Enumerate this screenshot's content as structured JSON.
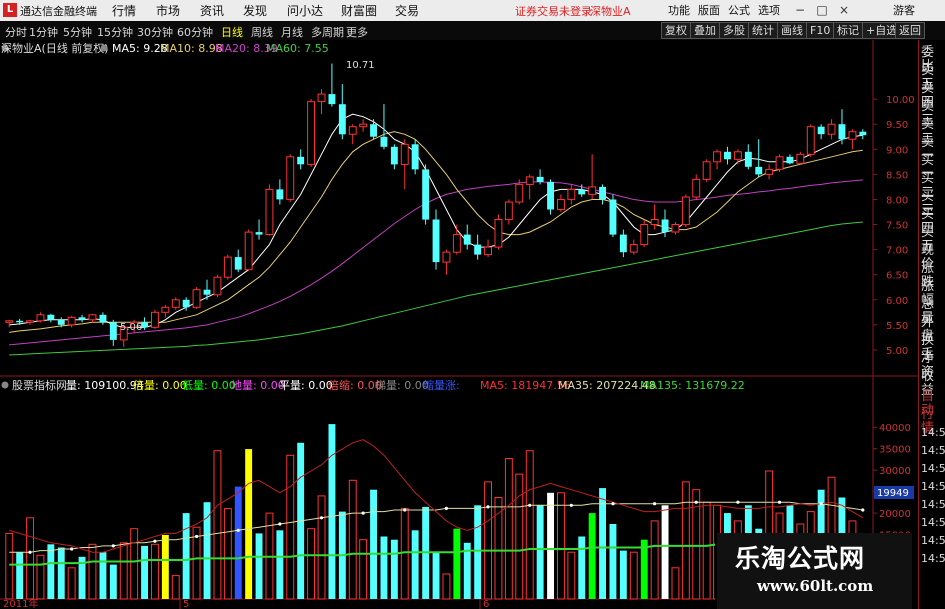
{
  "titlebar": {
    "app_name": "通达信金融终端",
    "menus": [
      "行情",
      "市场",
      "资讯",
      "发现",
      "问小达",
      "财富圈",
      "交易"
    ],
    "login_text": "证券交易未登录",
    "stock_text": "深物业A",
    "right_menus": [
      "功能",
      "版面",
      "公式",
      "选项"
    ],
    "guest": "游客"
  },
  "toolbar": {
    "periods": [
      "分时",
      "1分钟",
      "5分钟",
      "15分钟",
      "30分钟",
      "60分钟",
      "日线",
      "周线",
      "月线",
      "多周期",
      "更多"
    ],
    "active_period": "日线",
    "right_buttons": [
      "复权",
      "叠加",
      "多股",
      "统计",
      "画线",
      "F10",
      "标记",
      "+自选",
      "返回"
    ]
  },
  "main_chart": {
    "title": "深物业A(日线 前复权)",
    "ma5": "MA5: 9.28",
    "ma10": "MA10: 8.98",
    "ma20": "MA20: 8.39",
    "ma60": "MA60: 7.55",
    "max_label": "10.71",
    "min_label": "5.06",
    "price_axis": [
      "10.00",
      "9.50",
      "9.00",
      "8.50",
      "8.00",
      "7.50",
      "7.00",
      "6.50",
      "6.00",
      "5.50",
      "5.00"
    ]
  },
  "volume_chart": {
    "title": "股票指标网",
    "items": [
      {
        "label": "量: 109100.94",
        "color": "#ffffff"
      },
      {
        "label": "倍量: 0.00",
        "color": "#ffff00"
      },
      {
        "label": "低量: 0.00",
        "color": "#00ff00"
      },
      {
        "label": "地量: 0.00",
        "color": "#ff44ff"
      },
      {
        "label": "平量: 0.00",
        "color": "#ffffff"
      },
      {
        "label": "倍缩: 0.00",
        "color": "#ff5555"
      },
      {
        "label": "梯量: 0.00",
        "color": "#888888"
      },
      {
        "label": "缩量涨: ",
        "color": "#3355ff"
      },
      {
        "label": "MA5: 181947.56",
        "color": "#ff3030"
      },
      {
        "label": "MA35: 207224.48",
        "color": "#e0e0a0"
      },
      {
        "label": "MA135: 131679.22",
        "color": "#33dd33"
      }
    ],
    "volume_axis": [
      "40000",
      "35000",
      "30000",
      "25000",
      "20000",
      "15000"
    ],
    "current_value": "19949"
  },
  "date_axis": [
    "2011年",
    "5",
    "6"
  ],
  "right_panel": [
    "委比",
    "卖五",
    "卖四",
    "卖三",
    "卖二",
    "卖一",
    "买一",
    "买二",
    "买三",
    "买四",
    "买五",
    "现价",
    "涨跌",
    "涨幅",
    "总量",
    "外盘",
    "换手",
    "净资",
    "收益",
    "自动",
    "行情",
    "14:50",
    "14:50",
    "14:50",
    "14:50",
    "14:50",
    "14:50",
    "14:50",
    "14:50"
  ],
  "watermark": {
    "title": "乐淘公式网",
    "url": "www.60lt.com"
  },
  "chart_data": {
    "type": "candlestick",
    "title": "深物业A(日线 前复权)",
    "ylim": [
      4.6,
      10.9
    ],
    "ohlc": [
      [
        5.55,
        5.6,
        5.45,
        5.58
      ],
      [
        5.58,
        5.62,
        5.5,
        5.55
      ],
      [
        5.55,
        5.6,
        5.5,
        5.58
      ],
      [
        5.58,
        5.75,
        5.55,
        5.7
      ],
      [
        5.7,
        5.72,
        5.55,
        5.6
      ],
      [
        5.6,
        5.65,
        5.45,
        5.5
      ],
      [
        5.5,
        5.68,
        5.45,
        5.65
      ],
      [
        5.65,
        5.7,
        5.55,
        5.6
      ],
      [
        5.6,
        5.72,
        5.55,
        5.7
      ],
      [
        5.7,
        5.75,
        5.5,
        5.55
      ],
      [
        5.55,
        5.6,
        5.08,
        5.2
      ],
      [
        5.2,
        5.5,
        5.06,
        5.45
      ],
      [
        5.45,
        5.6,
        5.35,
        5.55
      ],
      [
        5.55,
        5.65,
        5.4,
        5.45
      ],
      [
        5.45,
        5.8,
        5.42,
        5.75
      ],
      [
        5.75,
        5.9,
        5.65,
        5.85
      ],
      [
        5.85,
        6.05,
        5.8,
        6.0
      ],
      [
        6.0,
        6.05,
        5.78,
        5.85
      ],
      [
        5.85,
        6.25,
        5.82,
        6.2
      ],
      [
        6.2,
        6.4,
        6.0,
        6.1
      ],
      [
        6.1,
        6.5,
        6.05,
        6.45
      ],
      [
        6.45,
        6.9,
        6.4,
        6.85
      ],
      [
        6.85,
        7.0,
        6.55,
        6.6
      ],
      [
        6.6,
        7.4,
        6.58,
        7.35
      ],
      [
        7.35,
        7.6,
        7.2,
        7.3
      ],
      [
        7.3,
        8.3,
        7.28,
        8.2
      ],
      [
        8.2,
        8.4,
        7.9,
        8.0
      ],
      [
        8.0,
        8.9,
        7.95,
        8.85
      ],
      [
        8.85,
        9.0,
        8.6,
        8.7
      ],
      [
        8.7,
        10.0,
        8.65,
        9.95
      ],
      [
        9.95,
        10.2,
        9.7,
        10.1
      ],
      [
        10.1,
        10.71,
        9.85,
        9.9
      ],
      [
        9.9,
        10.3,
        9.2,
        9.3
      ],
      [
        9.3,
        9.5,
        9.1,
        9.45
      ],
      [
        9.45,
        9.6,
        9.35,
        9.5
      ],
      [
        9.5,
        9.6,
        9.2,
        9.25
      ],
      [
        9.25,
        9.9,
        9.0,
        9.05
      ],
      [
        9.05,
        9.1,
        8.6,
        8.7
      ],
      [
        8.7,
        9.2,
        8.2,
        9.1
      ],
      [
        9.1,
        9.2,
        8.5,
        8.6
      ],
      [
        8.6,
        8.7,
        7.5,
        7.6
      ],
      [
        7.6,
        7.8,
        6.6,
        6.75
      ],
      [
        6.75,
        7.0,
        6.5,
        6.95
      ],
      [
        6.95,
        7.5,
        6.9,
        7.3
      ],
      [
        7.3,
        7.5,
        7.0,
        7.1
      ],
      [
        7.1,
        7.3,
        6.8,
        6.9
      ],
      [
        6.9,
        7.2,
        6.85,
        7.05
      ],
      [
        7.05,
        7.7,
        7.0,
        7.6
      ],
      [
        7.6,
        8.0,
        7.5,
        7.95
      ],
      [
        7.95,
        8.4,
        7.9,
        8.3
      ],
      [
        8.3,
        8.5,
        8.0,
        8.45
      ],
      [
        8.45,
        8.6,
        8.3,
        8.35
      ],
      [
        8.35,
        8.4,
        7.7,
        7.8
      ],
      [
        7.8,
        8.1,
        7.75,
        8.0
      ],
      [
        8.0,
        8.3,
        7.9,
        8.2
      ],
      [
        8.2,
        8.3,
        8.05,
        8.1
      ],
      [
        8.1,
        8.9,
        8.0,
        8.25
      ],
      [
        8.25,
        8.3,
        7.9,
        8.0
      ],
      [
        8.0,
        8.1,
        7.25,
        7.3
      ],
      [
        7.3,
        7.4,
        6.85,
        6.95
      ],
      [
        6.95,
        7.2,
        6.9,
        7.1
      ],
      [
        7.1,
        7.6,
        7.05,
        7.5
      ],
      [
        7.5,
        7.9,
        7.4,
        7.6
      ],
      [
        7.6,
        7.8,
        7.25,
        7.35
      ],
      [
        7.35,
        7.55,
        7.3,
        7.5
      ],
      [
        7.5,
        8.1,
        7.45,
        8.05
      ],
      [
        8.05,
        8.5,
        8.0,
        8.4
      ],
      [
        8.4,
        8.8,
        8.35,
        8.75
      ],
      [
        8.75,
        9.0,
        8.6,
        8.95
      ],
      [
        8.95,
        9.05,
        8.7,
        8.8
      ],
      [
        8.8,
        9.0,
        8.7,
        8.95
      ],
      [
        8.95,
        9.1,
        8.6,
        8.65
      ],
      [
        8.65,
        9.2,
        8.45,
        8.5
      ],
      [
        8.5,
        8.7,
        8.4,
        8.6
      ],
      [
        8.6,
        8.9,
        8.55,
        8.85
      ],
      [
        8.85,
        8.9,
        8.7,
        8.72
      ],
      [
        8.72,
        8.95,
        8.7,
        8.9
      ],
      [
        8.9,
        9.5,
        8.85,
        9.45
      ],
      [
        9.45,
        9.5,
        9.2,
        9.3
      ],
      [
        9.3,
        9.6,
        9.2,
        9.5
      ],
      [
        9.5,
        9.8,
        9.1,
        9.2
      ],
      [
        9.2,
        9.4,
        9.0,
        9.35
      ],
      [
        9.35,
        9.4,
        9.2,
        9.28
      ]
    ],
    "ma5": [
      5.5,
      5.52,
      5.55,
      5.58,
      5.6,
      5.6,
      5.6,
      5.6,
      5.62,
      5.6,
      5.5,
      5.45,
      5.45,
      5.45,
      5.5,
      5.6,
      5.75,
      5.85,
      5.95,
      6.05,
      6.15,
      6.3,
      6.45,
      6.6,
      6.85,
      7.1,
      7.5,
      7.8,
      8.1,
      8.5,
      8.9,
      9.3,
      9.6,
      9.7,
      9.65,
      9.55,
      9.4,
      9.2,
      9.1,
      8.95,
      8.6,
      8.2,
      7.8,
      7.4,
      7.15,
      7.05,
      7.05,
      7.1,
      7.25,
      7.5,
      7.75,
      8.0,
      8.15,
      8.2,
      8.2,
      8.2,
      8.15,
      8.1,
      7.95,
      7.7,
      7.45,
      7.3,
      7.3,
      7.35,
      7.4,
      7.55,
      7.8,
      8.05,
      8.3,
      8.55,
      8.75,
      8.82,
      8.8,
      8.75,
      8.75,
      8.75,
      8.8,
      8.9,
      9.0,
      9.1,
      9.2,
      9.25,
      9.28
    ],
    "ma10": [
      5.35,
      5.38,
      5.4,
      5.42,
      5.45,
      5.48,
      5.5,
      5.52,
      5.55,
      5.55,
      5.55,
      5.55,
      5.55,
      5.55,
      5.55,
      5.55,
      5.6,
      5.65,
      5.7,
      5.8,
      5.9,
      6.0,
      6.15,
      6.3,
      6.45,
      6.65,
      6.9,
      7.15,
      7.45,
      7.75,
      8.05,
      8.4,
      8.7,
      8.95,
      9.1,
      9.2,
      9.3,
      9.35,
      9.3,
      9.2,
      9.0,
      8.75,
      8.5,
      8.2,
      7.95,
      7.7,
      7.5,
      7.35,
      7.3,
      7.3,
      7.35,
      7.45,
      7.55,
      7.7,
      7.85,
      7.95,
      8.0,
      8.0,
      7.95,
      7.85,
      7.7,
      7.6,
      7.5,
      7.45,
      7.4,
      7.4,
      7.45,
      7.6,
      7.75,
      7.95,
      8.15,
      8.3,
      8.45,
      8.55,
      8.6,
      8.65,
      8.7,
      8.75,
      8.8,
      8.85,
      8.9,
      8.95,
      8.98
    ],
    "ma20": [
      5.1,
      5.12,
      5.14,
      5.16,
      5.18,
      5.2,
      5.22,
      5.24,
      5.26,
      5.28,
      5.3,
      5.32,
      5.34,
      5.36,
      5.38,
      5.4,
      5.42,
      5.44,
      5.47,
      5.5,
      5.55,
      5.6,
      5.65,
      5.72,
      5.8,
      5.88,
      5.97,
      6.07,
      6.18,
      6.3,
      6.43,
      6.57,
      6.72,
      6.88,
      7.04,
      7.2,
      7.36,
      7.52,
      7.66,
      7.8,
      7.92,
      8.02,
      8.1,
      8.15,
      8.2,
      8.23,
      8.26,
      8.28,
      8.3,
      8.33,
      8.35,
      8.35,
      8.34,
      8.33,
      8.3,
      8.25,
      8.2,
      8.15,
      8.1,
      8.05,
      8.0,
      7.97,
      7.95,
      7.95,
      7.95,
      7.97,
      8.0,
      8.02,
      8.05,
      8.08,
      8.1,
      8.12,
      8.15,
      8.17,
      8.2,
      8.22,
      8.25,
      8.28,
      8.3,
      8.33,
      8.35,
      8.37,
      8.39
    ],
    "ma60": [
      4.9,
      4.91,
      4.92,
      4.93,
      4.94,
      4.95,
      4.96,
      4.97,
      4.98,
      4.99,
      5.0,
      5.01,
      5.02,
      5.03,
      5.04,
      5.05,
      5.06,
      5.07,
      5.09,
      5.1,
      5.12,
      5.14,
      5.16,
      5.18,
      5.2,
      5.23,
      5.26,
      5.29,
      5.32,
      5.36,
      5.4,
      5.44,
      5.48,
      5.53,
      5.58,
      5.63,
      5.68,
      5.73,
      5.78,
      5.83,
      5.88,
      5.93,
      5.98,
      6.03,
      6.08,
      6.12,
      6.16,
      6.2,
      6.24,
      6.28,
      6.32,
      6.36,
      6.4,
      6.44,
      6.48,
      6.52,
      6.56,
      6.6,
      6.64,
      6.68,
      6.72,
      6.76,
      6.8,
      6.84,
      6.88,
      6.92,
      6.96,
      7.0,
      7.04,
      7.08,
      7.12,
      7.16,
      7.2,
      7.24,
      7.28,
      7.32,
      7.36,
      7.4,
      7.44,
      7.48,
      7.51,
      7.53,
      7.55
    ],
    "volumes": [
      42,
      30,
      52,
      28,
      35,
      33,
      20,
      27,
      35,
      30,
      22,
      36,
      45,
      34,
      35,
      41,
      15,
      55,
      46,
      62,
      95,
      58,
      72,
      96,
      42,
      55,
      44,
      92,
      100,
      45,
      66,
      112,
      56,
      76,
      38,
      70,
      40,
      38,
      58,
      44,
      59,
      30,
      16,
      45,
      36,
      60,
      75,
      65,
      90,
      80,
      95,
      60,
      68,
      68,
      30,
      40,
      55,
      71,
      48,
      31,
      30,
      38,
      50,
      60,
      20,
      75,
      70,
      62,
      60,
      55,
      50,
      60,
      45,
      82,
      55,
      60,
      48,
      56,
      70,
      78,
      65,
      50,
      28
    ],
    "vol_ma5": [
      44,
      42,
      40,
      38,
      36,
      35,
      34,
      32,
      30,
      30,
      32,
      34,
      36,
      38,
      40,
      42,
      42,
      45,
      48,
      52,
      60,
      64,
      68,
      74,
      76,
      72,
      68,
      72,
      78,
      82,
      86,
      92,
      96,
      100,
      102,
      98,
      92,
      84,
      76,
      68,
      62,
      56,
      50,
      46,
      44,
      46,
      50,
      55,
      60,
      66,
      70,
      72,
      74,
      72,
      70,
      68,
      66,
      64,
      62,
      60,
      58,
      56,
      56,
      57,
      58,
      58,
      59,
      60,
      60,
      59,
      58,
      58,
      58,
      59,
      59,
      60,
      61,
      60,
      61,
      62,
      60,
      56,
      52
    ],
    "vol_ma35": [
      30,
      30,
      30,
      31,
      31,
      32,
      32,
      33,
      33,
      34,
      34,
      35,
      36,
      36,
      37,
      38,
      38,
      39,
      40,
      41,
      42,
      43,
      44,
      45,
      46,
      47,
      48,
      49,
      50,
      51,
      52,
      53,
      54,
      55,
      55,
      56,
      56,
      57,
      57,
      57,
      57,
      57,
      58,
      58,
      58,
      58,
      59,
      59,
      59,
      59,
      60,
      60,
      60,
      60,
      60,
      60,
      61,
      61,
      61,
      61,
      61,
      61,
      61,
      61,
      61,
      62,
      62,
      62,
      62,
      62,
      62,
      62,
      62,
      62,
      62,
      62,
      61,
      61,
      61,
      60,
      59,
      58,
      57
    ],
    "vol_ma135": [
      22,
      22,
      22,
      22,
      23,
      23,
      23,
      23,
      24,
      24,
      24,
      24,
      24,
      25,
      25,
      25,
      25,
      25,
      26,
      26,
      26,
      26,
      26,
      27,
      27,
      27,
      27,
      27,
      28,
      28,
      28,
      28,
      28,
      29,
      29,
      29,
      29,
      29,
      30,
      30,
      30,
      30,
      30,
      30,
      31,
      31,
      31,
      31,
      31,
      31,
      32,
      32,
      32,
      32,
      32,
      32,
      33,
      33,
      33,
      33,
      33,
      33,
      34,
      34,
      34,
      34,
      34,
      34,
      35,
      35,
      35,
      35,
      35,
      35,
      35,
      36,
      36,
      36,
      36,
      36,
      36,
      36,
      36
    ],
    "vol_ylim": [
      0,
      130
    ]
  }
}
